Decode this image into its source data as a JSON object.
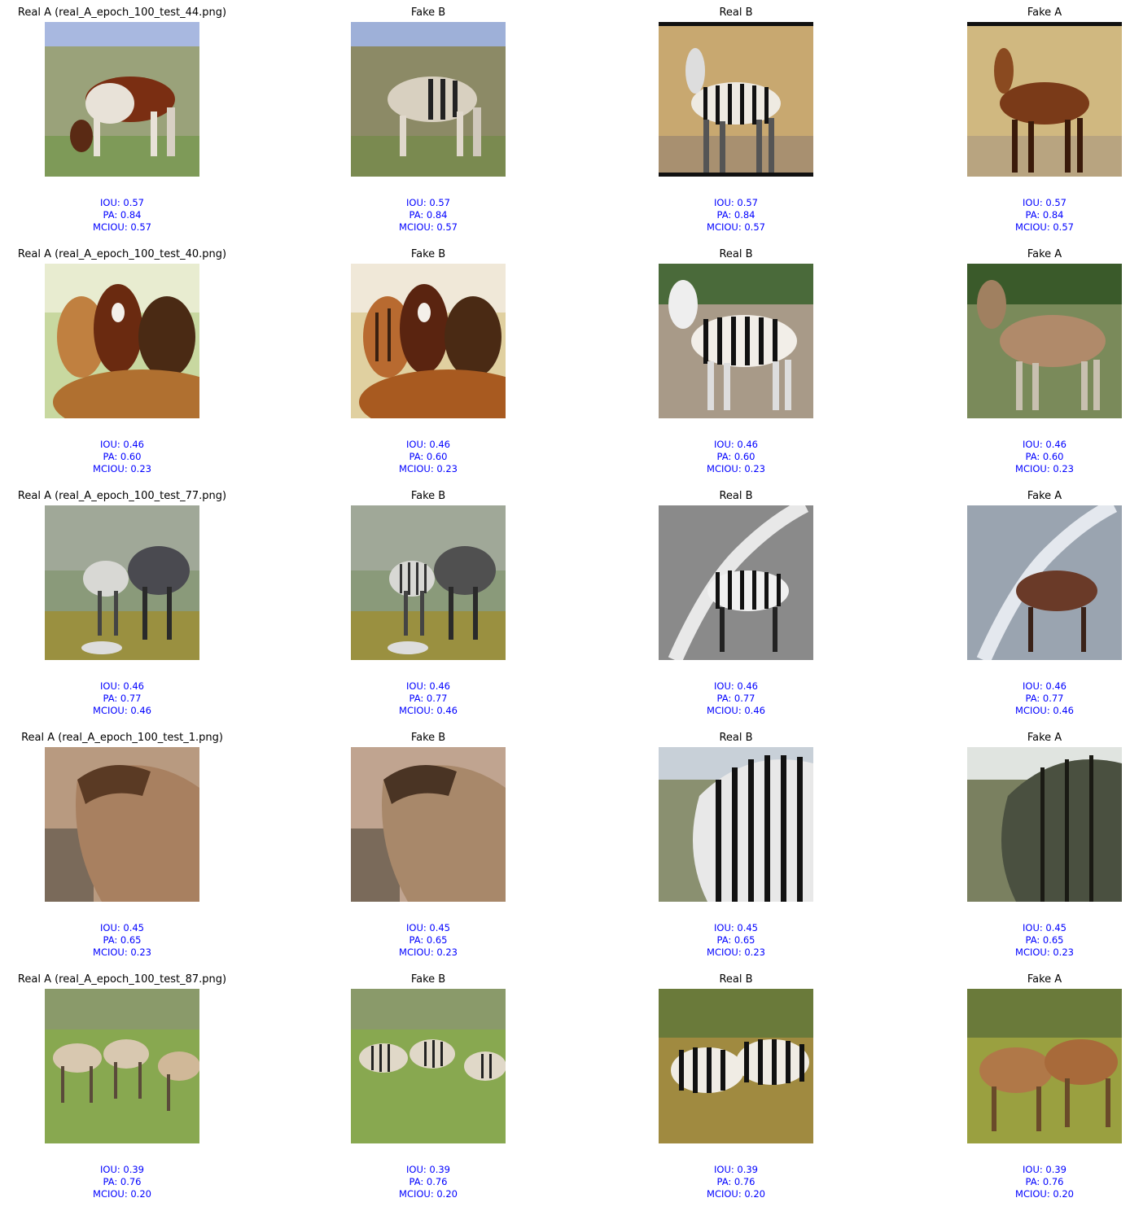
{
  "colors": {
    "title": "#000000",
    "metrics": "#0000ff",
    "background": "#ffffff"
  },
  "rows": [
    {
      "titles": [
        "Real A (real_A_epoch_100_test_44.png)",
        "Fake B",
        "Real B",
        "Fake A"
      ],
      "iou": "IOU: 0.57",
      "pa": "PA: 0.84",
      "mciou": "MCIOU: 0.57",
      "images": [
        "pinto horse grazing",
        "pinto horse with zebra stripes",
        "zebra on dry savanna",
        "brown horse on dry savanna"
      ]
    },
    {
      "titles": [
        "Real A (real_A_epoch_100_test_40.png)",
        "Fake B",
        "Real B",
        "Fake A"
      ],
      "iou": "IOU: 0.46",
      "pa": "PA: 0.60",
      "mciou": "MCIOU: 0.23",
      "images": [
        "group of brown horses",
        "brown horses with faint stripes",
        "zebra standing in pen",
        "tan horse standing in pen"
      ]
    },
    {
      "titles": [
        "Real A (real_A_epoch_100_test_77.png)",
        "Fake B",
        "Real B",
        "Fake A"
      ],
      "iou": "IOU: 0.46",
      "pa": "PA: 0.77",
      "mciou": "MCIOU: 0.46",
      "images": [
        "white and dark horses on hillside",
        "striped horses on hillside",
        "black and white zebra on path",
        "brown horse on path"
      ]
    },
    {
      "titles": [
        "Real A (real_A_epoch_100_test_1.png)",
        "Fake B",
        "Real B",
        "Fake A"
      ],
      "iou": "IOU: 0.45",
      "pa": "PA: 0.65",
      "mciou": "MCIOU: 0.23",
      "images": [
        "close up of tan horse",
        "tan horse with texture",
        "close up of zebra mane",
        "dark horse with stripes"
      ]
    },
    {
      "titles": [
        "Real A (real_A_epoch_100_test_87.png)",
        "Fake B",
        "Real B",
        "Fake A"
      ],
      "iou": "IOU: 0.39",
      "pa": "PA: 0.76",
      "mciou": "MCIOU: 0.20",
      "images": [
        "three pale horses grazing",
        "three zebras grazing",
        "two zebras in tall grass",
        "two brown horses in tall grass"
      ]
    }
  ]
}
